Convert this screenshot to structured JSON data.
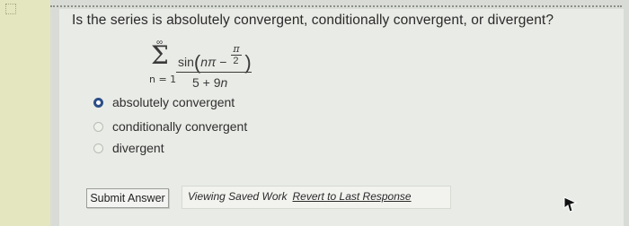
{
  "question": {
    "text": "Is the series is absolutely convergent, conditionally convergent, or divergent?"
  },
  "formula": {
    "upper_limit": "∞",
    "sigma": "Σ",
    "lower_limit": "n = 1",
    "numerator_prefix": "sin",
    "numerator_var": "nπ",
    "numerator_minus": "−",
    "inner_numerator": "π",
    "inner_denominator": "2",
    "denominator_const": "5 + 9",
    "denominator_var": "n"
  },
  "options": [
    {
      "label": "absolutely convergent",
      "selected": true
    },
    {
      "label": "conditionally convergent",
      "selected": false
    },
    {
      "label": "divergent",
      "selected": false
    }
  ],
  "footer": {
    "submit_label": "Submit Answer",
    "saved_text": "Viewing Saved Work",
    "revert_label": "Revert to Last Response"
  },
  "colors": {
    "selected_radio": "#2c4e88",
    "left_bar": "#e4e6bf"
  }
}
